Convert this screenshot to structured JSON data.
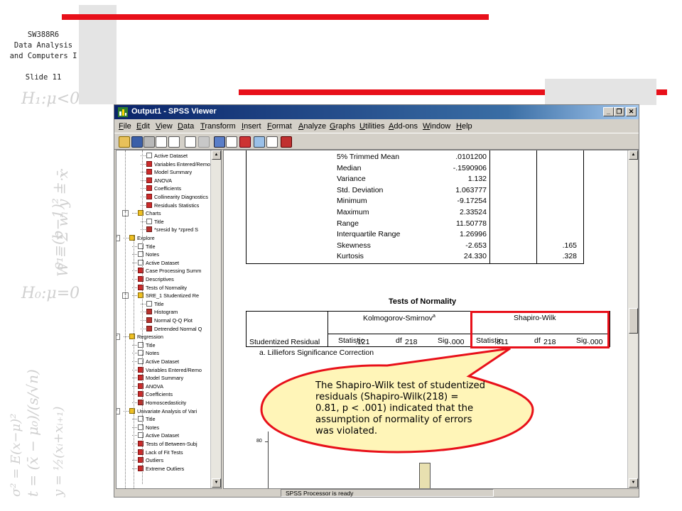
{
  "slide": {
    "course_code": "SW388R6",
    "course_name_line1": "Data Analysis",
    "course_name_line2": "and Computers I",
    "slide_number": "Slide 11"
  },
  "window": {
    "title": "Output1 - SPSS Viewer",
    "menus": [
      "File",
      "Edit",
      "View",
      "Data",
      "Transform",
      "Insert",
      "Format",
      "Analyze",
      "Graphs",
      "Utilities",
      "Add-ons",
      "Window",
      "Help"
    ],
    "status_text": "SPSS Processor is ready"
  },
  "tree": {
    "rows": [
      {
        "label": "Active Dataset",
        "icon": "doc"
      },
      {
        "label": "Variables Entered/Remo",
        "icon": "tbl"
      },
      {
        "label": "Model Summary",
        "icon": "tbl"
      },
      {
        "label": "ANOVA",
        "icon": "tbl"
      },
      {
        "label": "Coefficients",
        "icon": "tbl"
      },
      {
        "label": "Collinearity Diagnostics",
        "icon": "tbl"
      },
      {
        "label": "Residuals Statistics",
        "icon": "tbl"
      },
      {
        "label": "Charts",
        "icon": "book"
      },
      {
        "label": "Title",
        "icon": "doc"
      },
      {
        "label": "*sresid by *zpred S",
        "icon": "chart"
      },
      {
        "label": "Explore",
        "icon": "book"
      },
      {
        "label": "Title",
        "icon": "doc"
      },
      {
        "label": "Notes",
        "icon": "doc"
      },
      {
        "label": "Active Dataset",
        "icon": "doc"
      },
      {
        "label": "Case Processing Summ",
        "icon": "tbl"
      },
      {
        "label": "Descriptives",
        "icon": "tbl"
      },
      {
        "label": "Tests of Normality",
        "icon": "tbl"
      },
      {
        "label": "SRE_1  Studentized Re",
        "icon": "book"
      },
      {
        "label": "Title",
        "icon": "doc"
      },
      {
        "label": "Histogram",
        "icon": "chart"
      },
      {
        "label": "Normal Q-Q Plot",
        "icon": "chart"
      },
      {
        "label": "Detrended Normal Q",
        "icon": "chart"
      },
      {
        "label": "Regression",
        "icon": "book"
      },
      {
        "label": "Title",
        "icon": "doc"
      },
      {
        "label": "Notes",
        "icon": "doc"
      },
      {
        "label": "Active Dataset",
        "icon": "doc"
      },
      {
        "label": "Variables Entered/Remo",
        "icon": "tbl"
      },
      {
        "label": "Model Summary",
        "icon": "tbl"
      },
      {
        "label": "ANOVA",
        "icon": "tbl"
      },
      {
        "label": "Coefficients",
        "icon": "tbl"
      },
      {
        "label": "Homoscedasticity",
        "icon": "chart"
      },
      {
        "label": "Univariate Analysis of Vari",
        "icon": "book"
      },
      {
        "label": "Title",
        "icon": "doc"
      },
      {
        "label": "Notes",
        "icon": "doc"
      },
      {
        "label": "Active Dataset",
        "icon": "doc"
      },
      {
        "label": "Tests of Between-Subj",
        "icon": "tbl"
      },
      {
        "label": "Lack of Fit Tests",
        "icon": "tbl"
      },
      {
        "label": "Outliers",
        "icon": "tbl"
      },
      {
        "label": "Extreme Outliers",
        "icon": "tbl"
      }
    ]
  },
  "descriptives": {
    "rows": [
      {
        "label": "5% Trimmed Mean",
        "statistic": ".0101200",
        "std_error": ""
      },
      {
        "label": "Median",
        "statistic": "-.1590906",
        "std_error": ""
      },
      {
        "label": "Variance",
        "statistic": "1.132",
        "std_error": ""
      },
      {
        "label": "Std. Deviation",
        "statistic": "1.063777",
        "std_error": ""
      },
      {
        "label": "Minimum",
        "statistic": "-9.17254",
        "std_error": ""
      },
      {
        "label": "Maximum",
        "statistic": "2.33524",
        "std_error": ""
      },
      {
        "label": "Range",
        "statistic": "11.50778",
        "std_error": ""
      },
      {
        "label": "Interquartile Range",
        "statistic": "1.26996",
        "std_error": ""
      },
      {
        "label": "Skewness",
        "statistic": "-2.653",
        "std_error": ".165"
      },
      {
        "label": "Kurtosis",
        "statistic": "24.330",
        "std_error": ".328"
      }
    ]
  },
  "normality": {
    "title": "Tests of Normality",
    "group1": "Kolmogorov-Smirnov",
    "group1_sup": "a",
    "group2": "Shapiro-Wilk",
    "col_statistic": "Statistic",
    "col_df": "df",
    "col_sig": "Sig.",
    "row_label": "Studentized Residual",
    "ks_statistic": ".121",
    "ks_df": "218",
    "ks_sig": ".000",
    "sw_statistic": ".811",
    "sw_df": "218",
    "sw_sig": ".000",
    "footnote": "a.  Lilliefors Significance Correction"
  },
  "chart_area": {
    "axis_tick": "80"
  },
  "callout": {
    "line1": "The Shapiro-Wilk test of studentized",
    "line2": "residuals (Shapiro-Wilk(218) =",
    "line3": "0.81, p < .001) indicated that the",
    "line4": "assumption of normality of errors",
    "line5": "was violated."
  },
  "colors": {
    "accent_red": "#e8101a",
    "callout_fill": "#fff5b8",
    "title_bar": "#0a246a"
  }
}
